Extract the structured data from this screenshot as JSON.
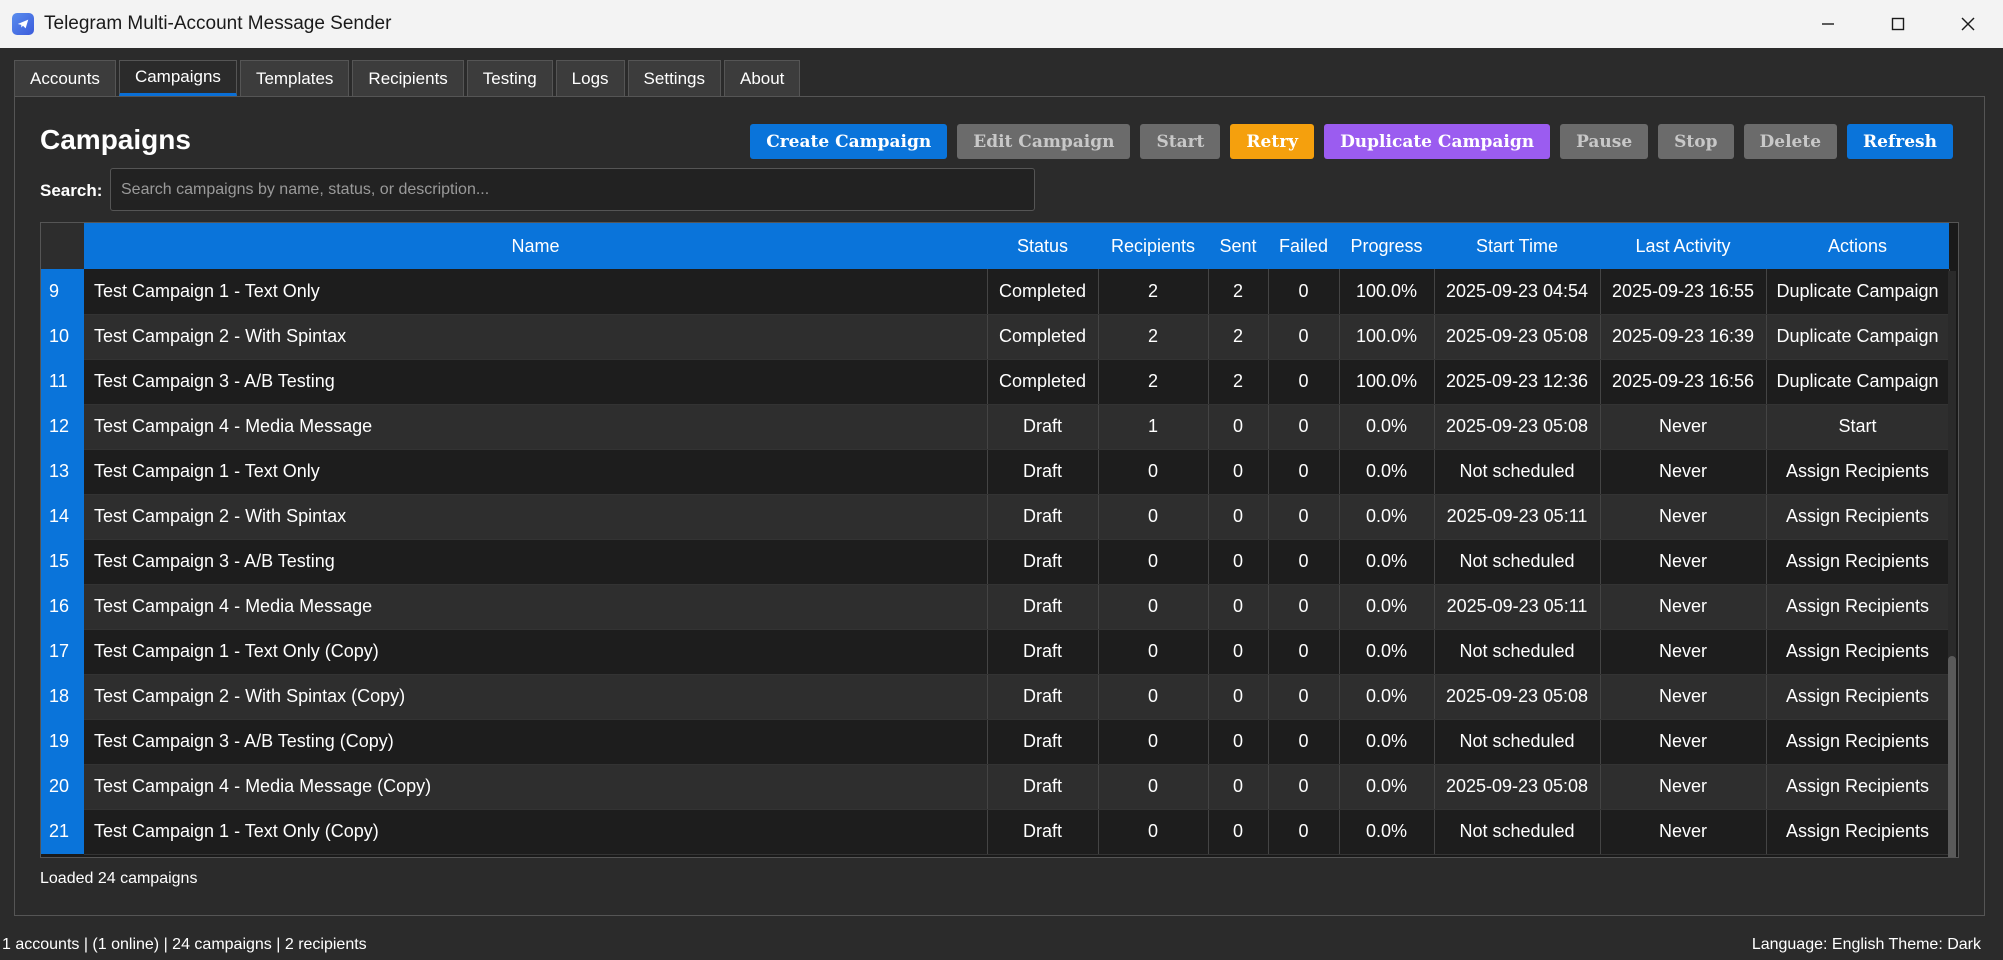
{
  "window": {
    "title": "Telegram Multi-Account Message Sender"
  },
  "tabs": [
    "Accounts",
    "Campaigns",
    "Templates",
    "Recipients",
    "Testing",
    "Logs",
    "Settings",
    "About"
  ],
  "active_tab": "Campaigns",
  "page": {
    "title": "Campaigns"
  },
  "toolbar": {
    "create": "Create Campaign",
    "edit": "Edit Campaign",
    "start": "Start",
    "retry": "Retry",
    "duplicate": "Duplicate Campaign",
    "pause": "Pause",
    "stop": "Stop",
    "delete": "Delete",
    "refresh": "Refresh"
  },
  "search": {
    "label": "Search:",
    "placeholder": "Search campaigns by name, status, or description...",
    "value": ""
  },
  "table": {
    "columns": [
      "Name",
      "Status",
      "Recipients",
      "Sent",
      "Failed",
      "Progress",
      "Start Time",
      "Last Activity",
      "Actions"
    ],
    "rows": [
      {
        "num": "9",
        "name": "Test Campaign 1 - Text Only",
        "status": "Completed",
        "recipients": "2",
        "sent": "2",
        "failed": "0",
        "progress": "100.0%",
        "start": "2025-09-23 04:54",
        "last": "2025-09-23 16:55",
        "action": "Duplicate Campaign"
      },
      {
        "num": "10",
        "name": "Test Campaign 2 - With Spintax",
        "status": "Completed",
        "recipients": "2",
        "sent": "2",
        "failed": "0",
        "progress": "100.0%",
        "start": "2025-09-23 05:08",
        "last": "2025-09-23 16:39",
        "action": "Duplicate Campaign"
      },
      {
        "num": "11",
        "name": "Test Campaign 3 - A/B Testing",
        "status": "Completed",
        "recipients": "2",
        "sent": "2",
        "failed": "0",
        "progress": "100.0%",
        "start": "2025-09-23 12:36",
        "last": "2025-09-23 16:56",
        "action": "Duplicate Campaign"
      },
      {
        "num": "12",
        "name": "Test Campaign 4 - Media Message",
        "status": "Draft",
        "recipients": "1",
        "sent": "0",
        "failed": "0",
        "progress": "0.0%",
        "start": "2025-09-23 05:08",
        "last": "Never",
        "action": "Start"
      },
      {
        "num": "13",
        "name": "Test Campaign 1 - Text Only",
        "status": "Draft",
        "recipients": "0",
        "sent": "0",
        "failed": "0",
        "progress": "0.0%",
        "start": "Not scheduled",
        "last": "Never",
        "action": "Assign Recipients"
      },
      {
        "num": "14",
        "name": "Test Campaign 2 - With Spintax",
        "status": "Draft",
        "recipients": "0",
        "sent": "0",
        "failed": "0",
        "progress": "0.0%",
        "start": "2025-09-23 05:11",
        "last": "Never",
        "action": "Assign Recipients"
      },
      {
        "num": "15",
        "name": "Test Campaign 3 - A/B Testing",
        "status": "Draft",
        "recipients": "0",
        "sent": "0",
        "failed": "0",
        "progress": "0.0%",
        "start": "Not scheduled",
        "last": "Never",
        "action": "Assign Recipients"
      },
      {
        "num": "16",
        "name": "Test Campaign 4 - Media Message",
        "status": "Draft",
        "recipients": "0",
        "sent": "0",
        "failed": "0",
        "progress": "0.0%",
        "start": "2025-09-23 05:11",
        "last": "Never",
        "action": "Assign Recipients"
      },
      {
        "num": "17",
        "name": "Test Campaign 1 - Text Only (Copy)",
        "status": "Draft",
        "recipients": "0",
        "sent": "0",
        "failed": "0",
        "progress": "0.0%",
        "start": "Not scheduled",
        "last": "Never",
        "action": "Assign Recipients"
      },
      {
        "num": "18",
        "name": "Test Campaign 2 - With Spintax (Copy)",
        "status": "Draft",
        "recipients": "0",
        "sent": "0",
        "failed": "0",
        "progress": "0.0%",
        "start": "2025-09-23 05:08",
        "last": "Never",
        "action": "Assign Recipients"
      },
      {
        "num": "19",
        "name": "Test Campaign 3 - A/B Testing (Copy)",
        "status": "Draft",
        "recipients": "0",
        "sent": "0",
        "failed": "0",
        "progress": "0.0%",
        "start": "Not scheduled",
        "last": "Never",
        "action": "Assign Recipients"
      },
      {
        "num": "20",
        "name": "Test Campaign 4 - Media Message (Copy)",
        "status": "Draft",
        "recipients": "0",
        "sent": "0",
        "failed": "0",
        "progress": "0.0%",
        "start": "2025-09-23 05:08",
        "last": "Never",
        "action": "Assign Recipients"
      },
      {
        "num": "21",
        "name": "Test Campaign 1 - Text Only (Copy)",
        "status": "Draft",
        "recipients": "0",
        "sent": "0",
        "failed": "0",
        "progress": "0.0%",
        "start": "Not scheduled",
        "last": "Never",
        "action": "Assign Recipients"
      }
    ]
  },
  "status_message": "Loaded 24 campaigns",
  "statusbar": {
    "left": "1 accounts | (1 online) | 24 campaigns | 2 recipients",
    "right": "Language: English  Theme: Dark"
  },
  "colors": {
    "accent": "#0a74da",
    "retry": "#f5a00d",
    "duplicate": "#9b5cf0",
    "disabled": "#6b6b6b",
    "background": "#2b2b2b"
  }
}
